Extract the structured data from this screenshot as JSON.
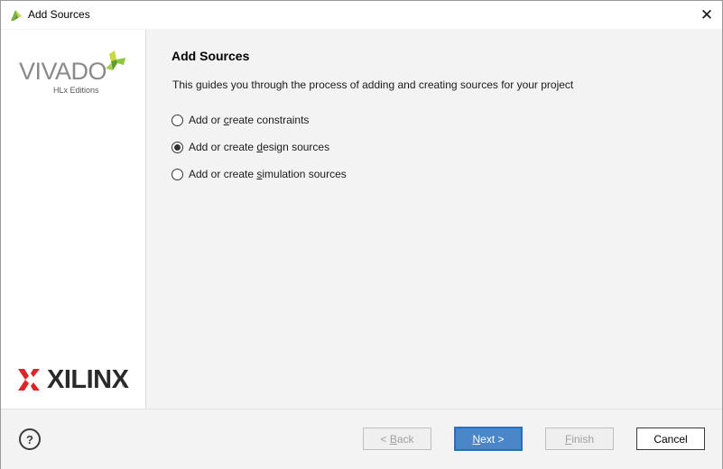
{
  "window": {
    "title": "Add Sources",
    "close_glyph": "✕"
  },
  "sidebar": {
    "product_logo": {
      "wordmark": "VIVADO",
      "edition": "HLx Editions",
      "icon": "vivado-leaf-icon"
    },
    "vendor_logo": {
      "wordmark": "XILINX",
      "registered": "®",
      "icon": "xilinx-x-icon"
    }
  },
  "main": {
    "title": "Add Sources",
    "description": "This guides you through the process of adding and creating sources for your project",
    "options": [
      {
        "prefix": "Add or ",
        "mnemonic": "c",
        "suffix": "reate constraints",
        "selected": false
      },
      {
        "prefix": "Add or create ",
        "mnemonic": "d",
        "suffix": "esign sources",
        "selected": true
      },
      {
        "prefix": "Add or create ",
        "mnemonic": "s",
        "suffix": "imulation sources",
        "selected": false
      }
    ]
  },
  "footer": {
    "help_glyph": "?",
    "back": {
      "prefix": "< ",
      "mnemonic": "B",
      "suffix": "ack",
      "enabled": false
    },
    "next": {
      "prefix": "",
      "mnemonic": "N",
      "suffix": "ext >",
      "enabled": true
    },
    "finish": {
      "prefix": "",
      "mnemonic": "F",
      "suffix": "inish",
      "enabled": false
    },
    "cancel": {
      "label": "Cancel",
      "enabled": true
    }
  },
  "colors": {
    "accent_blue": "#4a86c8",
    "vivado_gray": "#8a8a8a",
    "vivado_green": "#8dc63f",
    "xilinx_red": "#d9262b"
  }
}
